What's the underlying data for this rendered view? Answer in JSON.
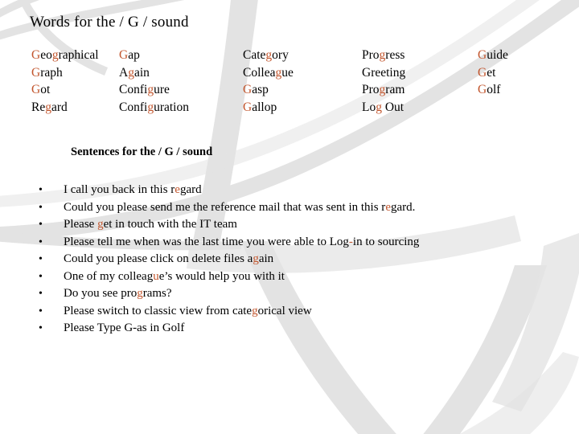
{
  "slide": {
    "title": "Words for the / G / sound",
    "subtitle": "Sentences for the / G  / sound",
    "accent_color": "#C2562E",
    "text_color": "#000000",
    "background_color": "#FFFFFF",
    "decoration_color": "#E3E3E3",
    "bullet_glyph": "•"
  },
  "word_columns": [
    {
      "words": [
        {
          "text": "Geographical",
          "highlight_indices": [
            0,
            3
          ]
        },
        {
          "text": "Graph",
          "highlight_indices": [
            0
          ]
        },
        {
          "text": "Got",
          "highlight_indices": [
            0
          ]
        },
        {
          "text": "Regard",
          "highlight_indices": [
            2
          ]
        }
      ]
    },
    {
      "words": [
        {
          "text": "Gap",
          "highlight_indices": [
            0
          ]
        },
        {
          "text": "Again",
          "highlight_indices": [
            1
          ]
        },
        {
          "text": "Configure",
          "highlight_indices": [
            5
          ]
        },
        {
          "text": "Configuration",
          "highlight_indices": [
            5
          ]
        }
      ]
    },
    {
      "words": [
        {
          "text": "Category",
          "highlight_indices": [
            4
          ]
        },
        {
          "text": "Colleague",
          "highlight_indices": [
            6
          ]
        },
        {
          "text": "Gasp",
          "highlight_indices": [
            0
          ]
        },
        {
          "text": "Gallop",
          "highlight_indices": [
            0
          ]
        }
      ]
    },
    {
      "words": [
        {
          "text": "Progress",
          "highlight_indices": [
            3
          ]
        },
        {
          "text": "Greeting",
          "highlight_indices": []
        },
        {
          "text": "Program",
          "highlight_indices": [
            3
          ]
        },
        {
          "text": "Log Out",
          "highlight_indices": [
            2
          ]
        }
      ]
    },
    {
      "words": [
        {
          "text": "Guide",
          "highlight_indices": [
            0
          ]
        },
        {
          "text": "Get",
          "highlight_indices": [
            0
          ]
        },
        {
          "text": "Golf",
          "highlight_indices": [
            0
          ]
        }
      ]
    }
  ],
  "sentences": [
    {
      "text": "I call you back in this regard",
      "highlight_indices": [
        25
      ]
    },
    {
      "text": "Could you please send me the reference mail that was sent in this regard.",
      "highlight_indices": [
        67
      ]
    },
    {
      "text": "Please get in touch with the IT team",
      "highlight_indices": [
        7
      ]
    },
    {
      "text": "Please tell me when was the last time you were able to Log-in to sourcing",
      "highlight_indices": [
        58
      ]
    },
    {
      "text": "Could you please click on delete files again",
      "highlight_indices": [
        40
      ]
    },
    {
      "text": "One of my colleague’s would help you with it",
      "highlight_indices": [
        17
      ]
    },
    {
      "text": "Do you see programs?",
      "highlight_indices": [
        14
      ]
    },
    {
      "text": "Please switch to classic view from categorical view",
      "highlight_indices": [
        39
      ]
    },
    {
      "text": "Please Type G-as in Golf",
      "highlight_indices": [
        19
      ]
    }
  ]
}
